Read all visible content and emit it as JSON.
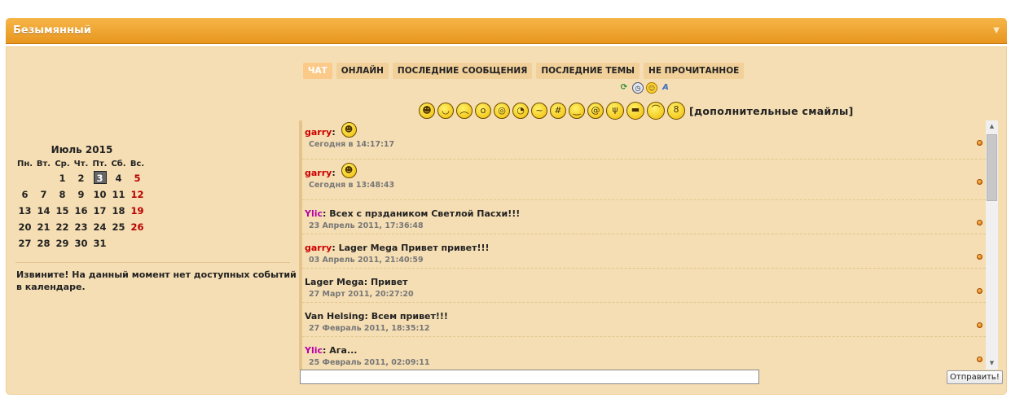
{
  "panel": {
    "title": "Безымянный",
    "collapse_icon": "chevron-down-icon"
  },
  "calendar": {
    "month": "Июль 2015",
    "weekdays": [
      "Пн.",
      "Вт.",
      "Ср.",
      "Чт.",
      "Пт.",
      "Сб.",
      "Вс."
    ],
    "weeks": [
      [
        "",
        "",
        "1",
        "2",
        "3",
        "4",
        "5"
      ],
      [
        "6",
        "7",
        "8",
        "9",
        "10",
        "11",
        "12"
      ],
      [
        "13",
        "14",
        "15",
        "16",
        "17",
        "18",
        "19"
      ],
      [
        "20",
        "21",
        "22",
        "23",
        "24",
        "25",
        "26"
      ],
      [
        "27",
        "28",
        "29",
        "30",
        "31",
        "",
        ""
      ]
    ],
    "today": "3",
    "sunday_color": "#b80000",
    "message": "Извините! На данный момент нет доступных событий в календаре."
  },
  "tabs": [
    "ЧАТ",
    "ОНЛАЙН",
    "ПОСЛЕДНИЕ СООБЩЕНИЯ",
    "ПОСЛЕДНИЕ ТЕМЫ",
    "НЕ ПРОЧИТАННОЕ"
  ],
  "active_tab": 0,
  "tools": [
    "refresh-icon",
    "clock-icon",
    "smiley-icon",
    "font-icon"
  ],
  "smilies": [
    "grin",
    "smile",
    "sad",
    "surprised",
    "shocked",
    "rolleyes",
    "confused",
    "zipped",
    "wink",
    "dizzy",
    "devil",
    "cool-hair",
    "cap",
    "nerd"
  ],
  "more_smilies": "[дополнительные смайлы]",
  "messages": [
    {
      "author": "garry",
      "author_color": "#cc0000",
      "text": "",
      "smiley": true,
      "time": "Сегодня в 14:17:17"
    },
    {
      "author": "garry",
      "author_color": "#cc0000",
      "text": "",
      "smiley": true,
      "time": "Сегодня в 13:48:43"
    },
    {
      "author": "Ylic",
      "author_color": "#b800a8",
      "text": "Всех с прздаником Светлой Пасхи!!!",
      "smiley": false,
      "time": "23 Апрель 2011, 17:36:48"
    },
    {
      "author": "garry",
      "author_color": "#cc0000",
      "text": "Lager Mega Привет привет!!!",
      "smiley": false,
      "time": "03 Апрель 2011, 21:40:59"
    },
    {
      "author": "Lager Mega",
      "author_color": "#222222",
      "text": "Привет",
      "smiley": false,
      "time": "27 Март 2011, 20:27:20"
    },
    {
      "author": "Van Helsing",
      "author_color": "#222222",
      "text": "Всем привет!!!",
      "smiley": false,
      "time": "27 Февраль 2011, 18:35:12"
    },
    {
      "author": "Ylic",
      "author_color": "#b800a8",
      "text": "Ага...",
      "smiley": false,
      "time": "25 Февраль 2011, 02:09:11"
    }
  ],
  "input": {
    "value": "",
    "placeholder": ""
  },
  "send_label": "Отправить!",
  "colors": {
    "header": "#e8971f",
    "body": "#f5deb3",
    "active_tab": "#fbc988"
  }
}
